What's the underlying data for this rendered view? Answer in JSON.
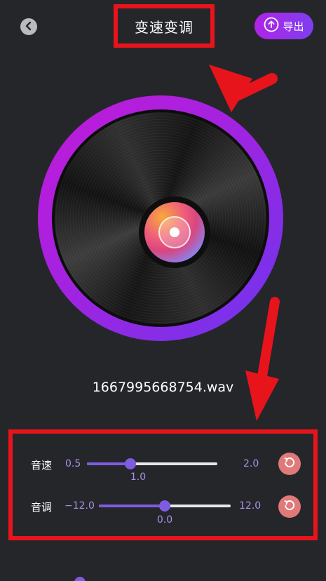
{
  "header": {
    "title": "变速变调",
    "export_label": "导出"
  },
  "player": {
    "filename": "1667995668754.wav"
  },
  "controls": {
    "speed": {
      "label": "音速",
      "min_label": "0.5",
      "max_label": "2.0",
      "min": 0.5,
      "max": 2.0,
      "value": 1.0,
      "value_label": "1.0"
    },
    "pitch": {
      "label": "音调",
      "min_label": "−12.0",
      "max_label": "12.0",
      "min": -12.0,
      "max": 12.0,
      "value": 0.0,
      "value_label": "0.0"
    }
  },
  "colors": {
    "background": "#25262a",
    "accent_purple": "#7e5ce0",
    "export_gradient_start": "#b024e6",
    "export_gradient_end": "#7e3ef0",
    "annotation_red": "#e8141c",
    "reset_button": "#e07a78",
    "value_text": "#a990e8"
  },
  "icons": {
    "back": "chevron-left-icon",
    "export": "upload-icon",
    "reset": "reset-icon"
  }
}
